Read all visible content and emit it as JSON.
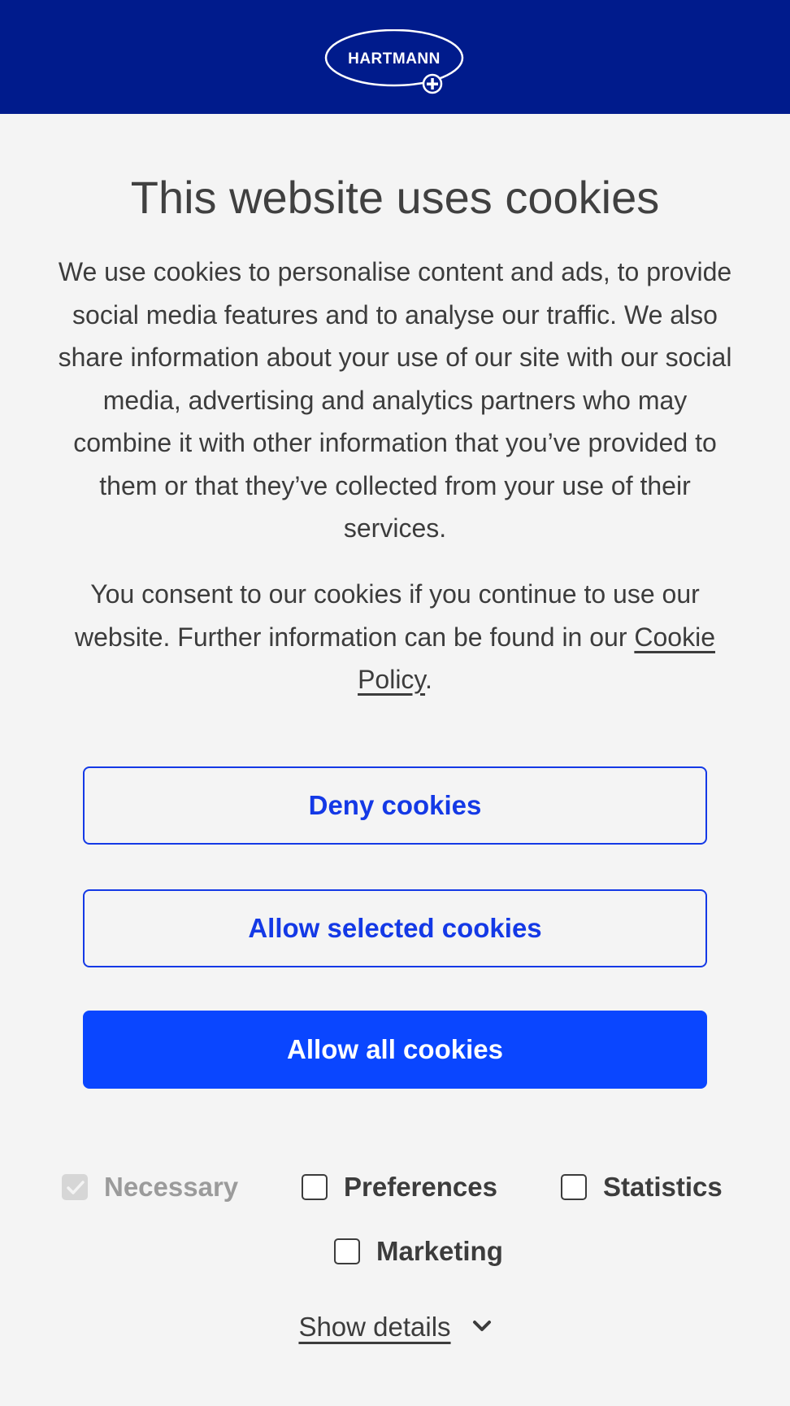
{
  "header": {
    "logo_text": "HARTMANN",
    "background": "#001b8c"
  },
  "dialog": {
    "title": "This website uses cookies",
    "paragraph1": "We use cookies to personalise content and ads, to provide social media features and to analyse our traffic. We also share information about your use of our site with our social media, advertising and analytics partners who may combine it with other information that you’ve provided to them or that they’ve collected from your use of their services.",
    "paragraph2_before": "You consent to our cookies if you continue to use our website. Further information can be found in our ",
    "paragraph2_link": "Cookie Policy",
    "paragraph2_after": "."
  },
  "buttons": {
    "deny": "Deny cookies",
    "allow_selected": "Allow selected cookies",
    "allow_all": "Allow all cookies",
    "accent": "#0a46ff"
  },
  "options": {
    "necessary": {
      "label": "Necessary",
      "checked": true,
      "disabled": true
    },
    "preferences": {
      "label": "Preferences",
      "checked": false
    },
    "statistics": {
      "label": "Statistics",
      "checked": false
    },
    "marketing": {
      "label": "Marketing",
      "checked": false
    }
  },
  "details": {
    "label": "Show details",
    "icon": "chevron-down-icon"
  }
}
